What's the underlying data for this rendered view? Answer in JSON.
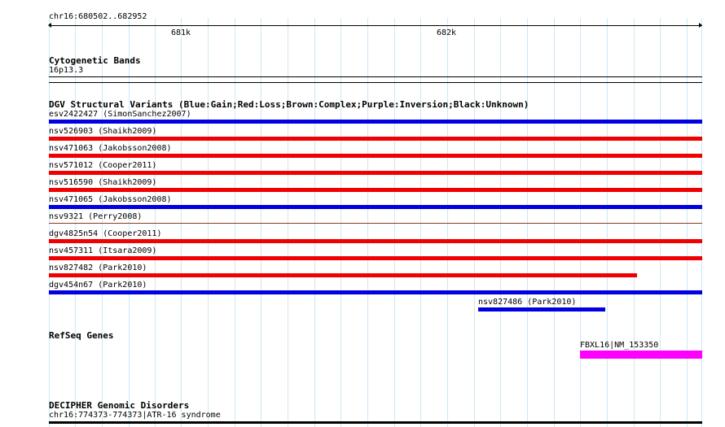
{
  "ruler": {
    "range_label": "chr16:680502..682952",
    "tick_labels": [
      "681k",
      "682k"
    ]
  },
  "tracks": {
    "cytoband": {
      "title": "Cytogenetic Bands",
      "band_label": "16p13.3"
    },
    "dgv": {
      "title": "DGV Structural Variants (Blue:Gain;Red:Loss;Brown:Complex;Purple:Inversion;Black:Unknown)",
      "colors": {
        "gain": "#0000e0",
        "loss": "#f00000",
        "complex": "#8b3a1a"
      },
      "items": [
        {
          "label": "esv2422427 (SimonSanchez2007)",
          "type": "gain"
        },
        {
          "label": "nsv526903 (Shaikh2009)",
          "type": "loss"
        },
        {
          "label": "nsv471063 (Jakobsson2008)",
          "type": "loss"
        },
        {
          "label": "nsv571012 (Cooper2011)",
          "type": "loss"
        },
        {
          "label": "nsv516590 (Shaikh2009)",
          "type": "loss"
        },
        {
          "label": "nsv471065 (Jakobsson2008)",
          "type": "gain"
        },
        {
          "label": "nsv9321 (Perry2008)",
          "type": "complex"
        },
        {
          "label": "dgv4825n54 (Cooper2011)",
          "type": "loss"
        },
        {
          "label": "nsv457311 (Itsara2009)",
          "type": "loss"
        },
        {
          "label": "nsv827482 (Park2010)",
          "type": "loss"
        },
        {
          "label": "dgv454n67 (Park2010)",
          "type": "gain"
        },
        {
          "label": "nsv827486 (Park2010)",
          "type": "gain"
        }
      ]
    },
    "refseq": {
      "title": "RefSeq Genes",
      "gene_label": "FBXL16|NM_153350",
      "gene_color": "#ff00ff"
    },
    "decipher": {
      "title": "DECIPHER Genomic Disorders",
      "item_label": "chr16:774373-774373|ATR-16 syndrome"
    }
  }
}
